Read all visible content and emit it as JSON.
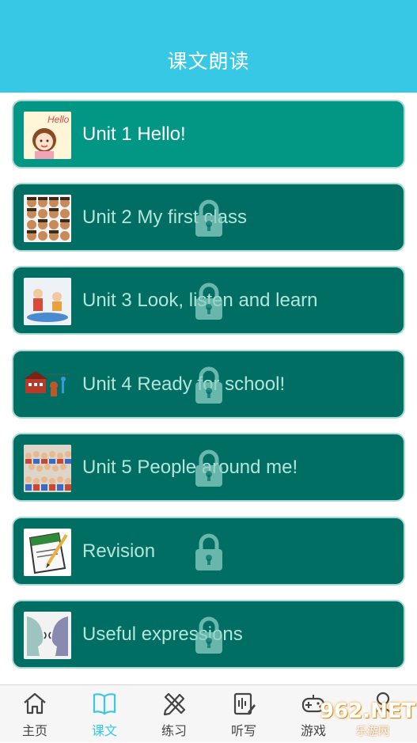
{
  "header": {
    "title": "课文朗读"
  },
  "lessons": [
    {
      "label": "Unit 1 Hello!",
      "locked": false,
      "thumb": "hello-girl-image"
    },
    {
      "label": "Unit 2 My first class",
      "locked": true,
      "thumb": "kids-faces-grid-image"
    },
    {
      "label": "Unit 3 Look, listen and learn",
      "locked": true,
      "thumb": "children-playing-image"
    },
    {
      "label": "Unit 4 Ready for school!",
      "locked": true,
      "thumb": "school-building-image"
    },
    {
      "label": "Unit 5 People around me!",
      "locked": true,
      "thumb": "crowd-of-people-image"
    },
    {
      "label": "Revision",
      "locked": true,
      "thumb": "notepad-pencil-image"
    },
    {
      "label": "Useful expressions",
      "locked": true,
      "thumb": "two-faces-talking-image"
    }
  ],
  "nav": {
    "items": [
      {
        "label": "主页",
        "icon": "home-icon",
        "active": false
      },
      {
        "label": "课文",
        "icon": "book-icon",
        "active": true
      },
      {
        "label": "练习",
        "icon": "pencil-ruler-icon",
        "active": false
      },
      {
        "label": "听写",
        "icon": "dictation-icon",
        "active": false
      },
      {
        "label": "游戏",
        "icon": "gamepad-icon",
        "active": false
      },
      {
        "label": "",
        "icon": "profile-icon",
        "active": false
      }
    ]
  },
  "watermark": {
    "text": "962.NET",
    "sub": "乐游网"
  },
  "colors": {
    "header": "#36c8e4",
    "card_unlocked": "#029784",
    "card_locked": "#006e62",
    "accent": "#36c8e4"
  }
}
